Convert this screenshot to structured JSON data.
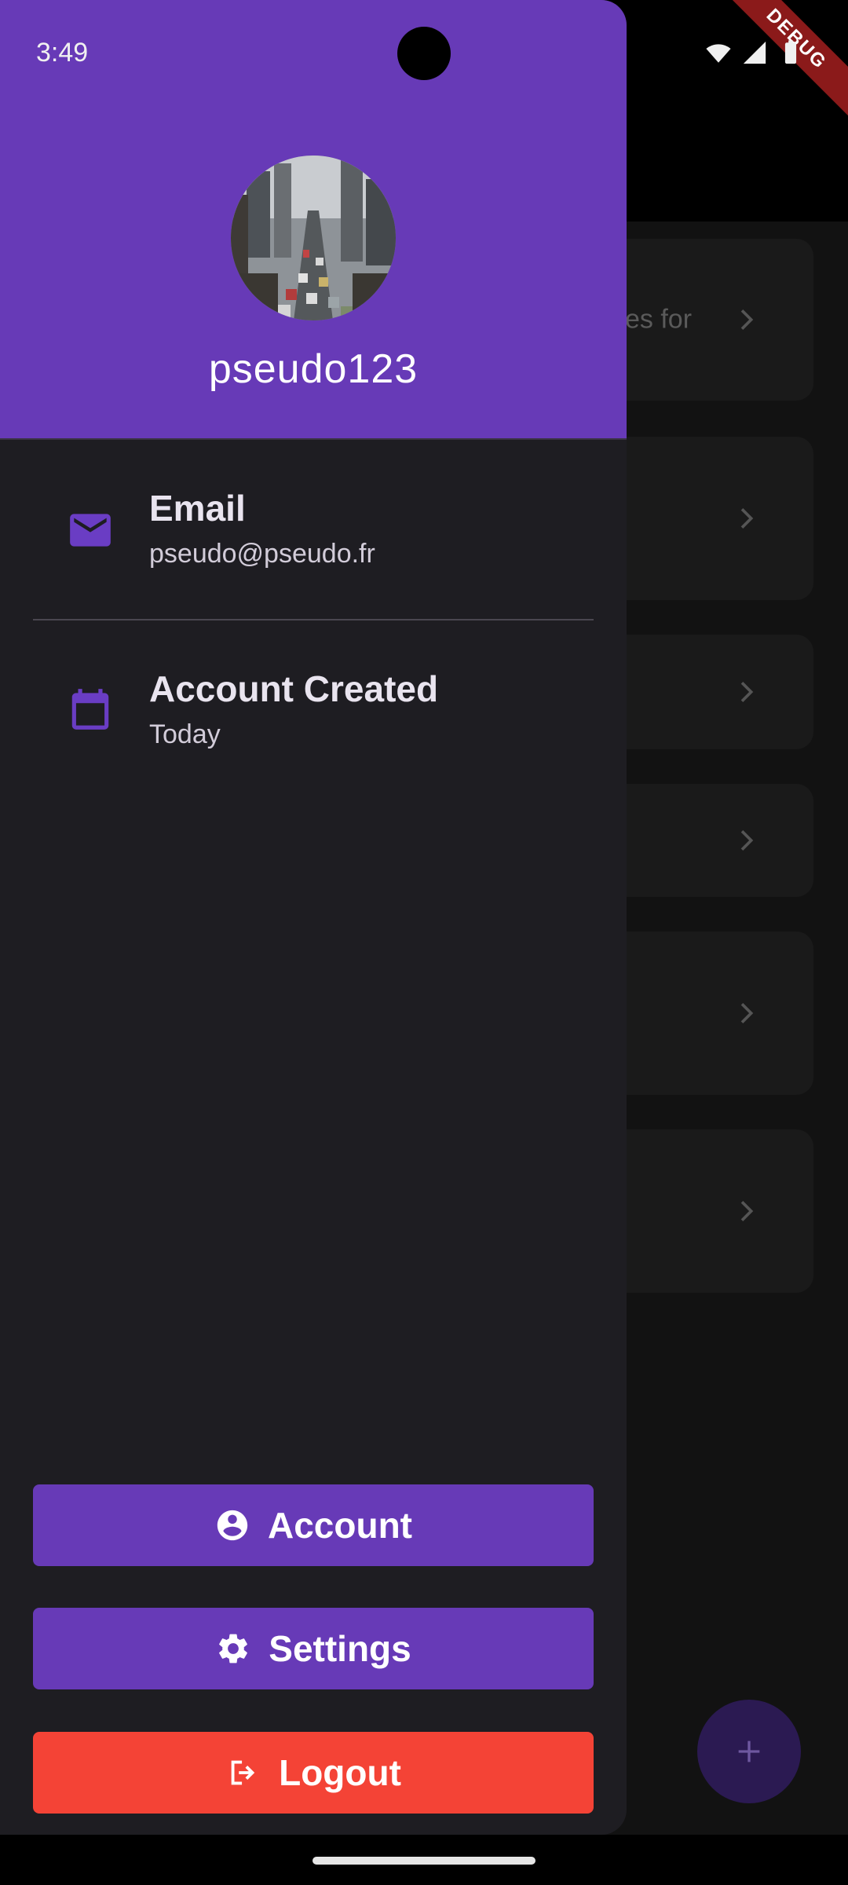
{
  "status_bar": {
    "time": "3:49",
    "debug_label": "DEBUG"
  },
  "background": {
    "card_snippet": "es for",
    "fab_icon": "plus-icon"
  },
  "drawer": {
    "username": "pseudo123",
    "avatar_icon": "city-traffic-photo",
    "items": [
      {
        "title": "Email",
        "subtitle": "pseudo@pseudo.fr",
        "icon": "email-icon"
      },
      {
        "title": "Account Created",
        "subtitle": "Today",
        "icon": "calendar-icon"
      }
    ],
    "buttons": {
      "account": "Account",
      "settings": "Settings",
      "logout": "Logout"
    }
  },
  "colors": {
    "accent": "#673ab7",
    "danger": "#f44336",
    "drawer_bg": "#1e1d22"
  }
}
